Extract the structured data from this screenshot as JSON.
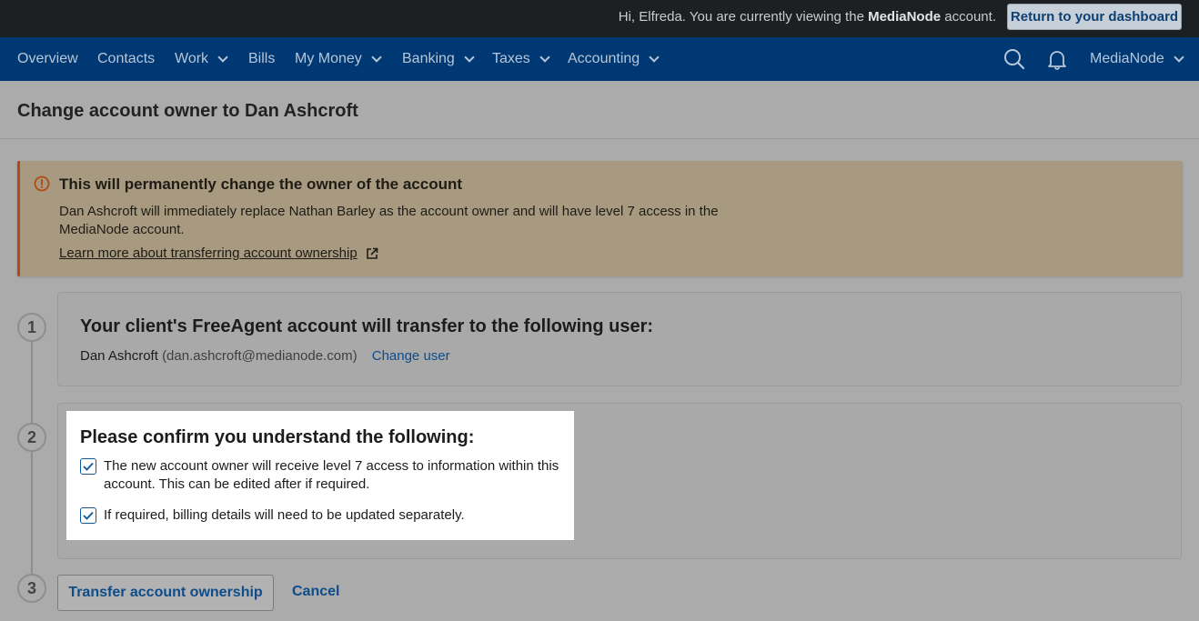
{
  "topbar": {
    "greeting_prefix": "Hi, Elfreda. You are currently viewing the",
    "account_name": "MediaNode",
    "greeting_suffix": "account.",
    "dashboard_button": "Return to your dashboard"
  },
  "nav": {
    "items": [
      {
        "label": "Overview"
      },
      {
        "label": "Contacts"
      },
      {
        "label": "Work"
      },
      {
        "label": "Bills"
      },
      {
        "label": "My Money"
      },
      {
        "label": "Banking"
      },
      {
        "label": "Taxes"
      },
      {
        "label": "Accounting"
      }
    ],
    "search_icon": "search-icon",
    "notification_icon": "bell-icon",
    "account_menu": "MediaNode"
  },
  "page": {
    "title": "Change account owner to Dan Ashcroft"
  },
  "alert": {
    "icon": "warning-icon",
    "title": "This will permanently change the owner of the account",
    "body": "Dan Ashcroft will immediately replace Nathan Barley as the account owner and will have level 7 access in the MediaNode account.",
    "link": "Learn more about transferring account ownership",
    "link_icon": "external-link-icon"
  },
  "steps": {
    "one": {
      "number": "1",
      "title": "Your client's FreeAgent account will transfer to the following user:",
      "user_name": "Dan Ashcroft",
      "user_email": "(dan.ashcroft@medianode.com)",
      "change_user": "Change user"
    },
    "two": {
      "number": "2",
      "title": "Please confirm you understand the following:",
      "checks": [
        {
          "label": "The new account owner will receive level 7 access to information within this account. This can be edited after if required.",
          "checked": true
        },
        {
          "label": "If required, billing details will need to be updated separately.",
          "checked": true
        }
      ]
    },
    "three": {
      "number": "3",
      "transfer_button": "Transfer account ownership",
      "cancel": "Cancel"
    }
  },
  "colors": {
    "nav_bg": "#003873",
    "link": "#0f4c8a",
    "alert_border": "#b04b18",
    "alert_bg": "#a79a80"
  }
}
